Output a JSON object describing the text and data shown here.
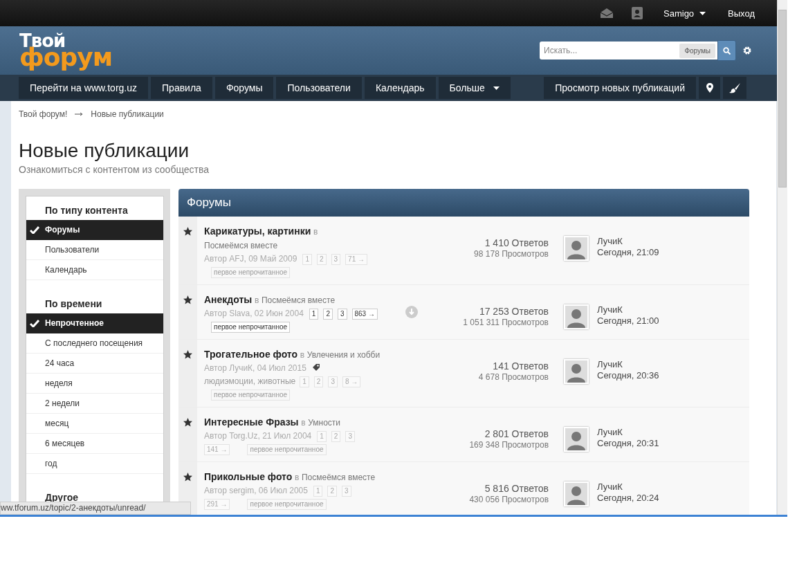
{
  "top_bar": {
    "user": "Samigo",
    "logout": "Выход"
  },
  "header": {
    "logo_top": "Твой",
    "logo_bottom": "форум",
    "search": {
      "placeholder": "Искать...",
      "scope": "Форумы"
    }
  },
  "nav": {
    "items": [
      {
        "label": "Перейти на www.torg.uz",
        "dropdown": false
      },
      {
        "label": "Правила",
        "dropdown": false
      },
      {
        "label": "Форумы",
        "dropdown": false
      },
      {
        "label": "Пользователи",
        "dropdown": false
      },
      {
        "label": "Календарь",
        "dropdown": false
      },
      {
        "label": "Больше",
        "dropdown": true
      }
    ],
    "right_item": "Просмотр новых публикаций"
  },
  "breadcrumb": [
    "Твой форум!",
    "Новые публикации"
  ],
  "page": {
    "title": "Новые публикации",
    "subtitle": "Ознакомиться с контентом из сообщества"
  },
  "sidebar": {
    "sections": [
      {
        "title": "По типу контента",
        "items": [
          {
            "label": "Форумы",
            "selected": true
          },
          {
            "label": "Пользователи",
            "selected": false
          },
          {
            "label": "Календарь",
            "selected": false
          }
        ]
      },
      {
        "title": "По времени",
        "items": [
          {
            "label": "Непрочтенное",
            "selected": true
          },
          {
            "label": "С последнего посещения",
            "selected": false
          },
          {
            "label": "24 часа",
            "selected": false
          },
          {
            "label": "неделя",
            "selected": false
          },
          {
            "label": "2 недели",
            "selected": false
          },
          {
            "label": "месяц",
            "selected": false
          },
          {
            "label": "6 месяцев",
            "selected": false
          },
          {
            "label": "год",
            "selected": false
          }
        ]
      },
      {
        "title": "Другое"
      }
    ]
  },
  "panel": {
    "title": "Форумы",
    "rows": [
      {
        "title": "Карикатуры, картинки",
        "prefix": "в",
        "forum": "Посмеёмся вместе",
        "author": "Автор AFJ, 09 Май 2009",
        "tags": "",
        "pages": [
          "1",
          "2",
          "3",
          "71 →"
        ],
        "unread": "первое непрочитанное",
        "hovered": false,
        "replies": "1 410 Ответов",
        "views": "98 178 Просмотров",
        "last_user": "ЛучиК",
        "last_time": "Сегодня, 21:09"
      },
      {
        "title": "Анекдоты",
        "prefix": "в",
        "forum": "Посмеёмся вместе",
        "author": "Автор Slava, 02 Июн 2004",
        "tags": "",
        "pages": [
          "1",
          "2",
          "3",
          "863 →"
        ],
        "unread": "первое непрочитанное",
        "hovered": true,
        "replies": "17 253 Ответов",
        "views": "1 051 311 Просмотров",
        "last_user": "ЛучиК",
        "last_time": "Сегодня, 21:00"
      },
      {
        "title": "Трогательное фото",
        "prefix": "в",
        "forum": "Увлечения и хобби",
        "author": "Автор ЛучиК, 04 Июл 2015",
        "tags": "людиэмоции, животные",
        "pages": [
          "1",
          "2",
          "3",
          "8 →"
        ],
        "unread": "первое непрочитанное",
        "hovered": false,
        "replies": "141 Ответов",
        "views": "4 678 Просмотров",
        "last_user": "ЛучиК",
        "last_time": "Сегодня, 20:36"
      },
      {
        "title": "Интересные Фразы",
        "prefix": "в",
        "forum": "Умности",
        "author": "Автор Torg.Uz, 21 Июл 2004",
        "tags": "",
        "pages": [
          "1",
          "2",
          "3",
          "141 →"
        ],
        "unread": "первое непрочитанное",
        "hovered": false,
        "replies": "2 801 Ответов",
        "views": "169 348 Просмотров",
        "last_user": "ЛучиК",
        "last_time": "Сегодня, 20:31"
      },
      {
        "title": "Прикольные фото",
        "prefix": "в",
        "forum": "Посмеёмся вместе",
        "author": "Автор sergim, 06 Июл 2005",
        "tags": "",
        "pages": [
          "1",
          "2",
          "3",
          "291 →"
        ],
        "unread": "первое непрочитанное",
        "hovered": false,
        "replies": "5 816 Ответов",
        "views": "430 056 Просмотров",
        "last_user": "ЛучиК",
        "last_time": "Сегодня, 20:24"
      }
    ]
  },
  "status_url": "ww.tforum.uz/topic/2-анекдоты/unread/"
}
